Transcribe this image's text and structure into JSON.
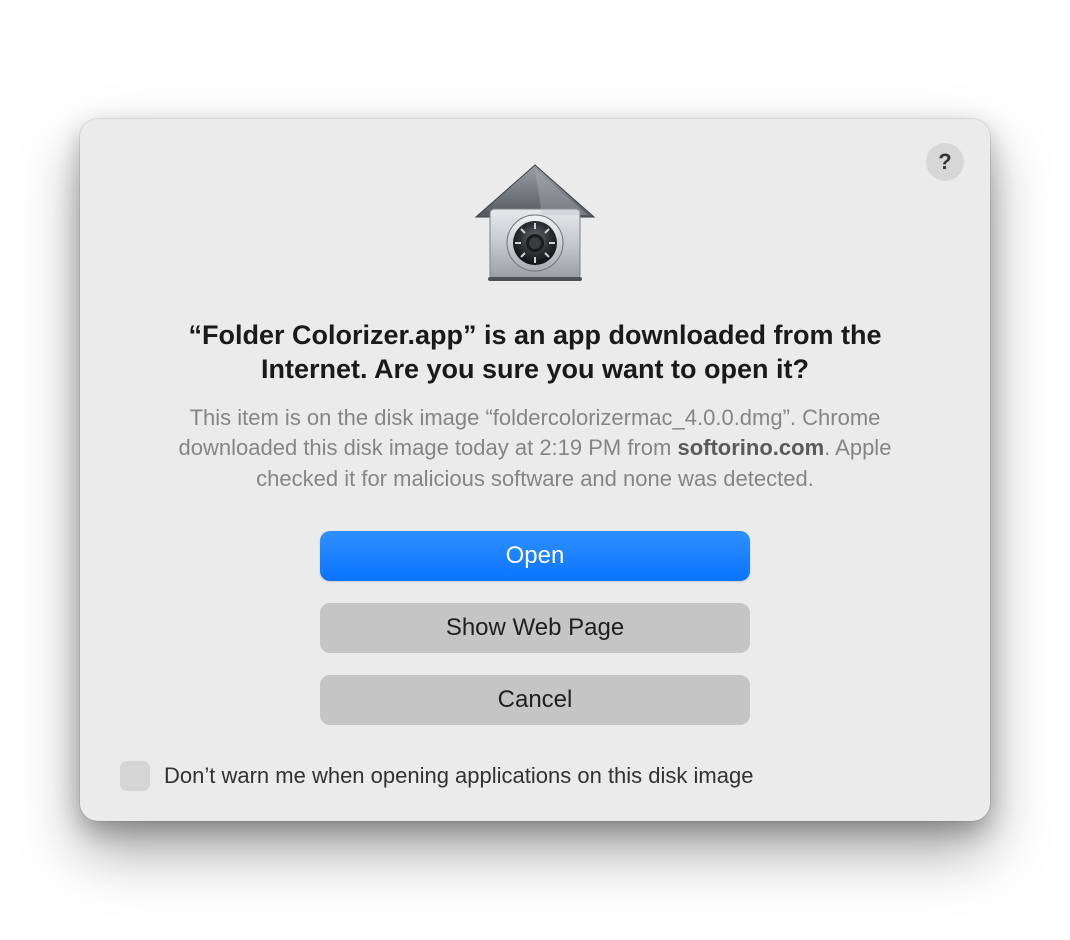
{
  "dialog": {
    "title": "“Folder Colorizer.app” is an app downloaded from the Internet. Are you sure you want to open it?",
    "subtitle_before": "This item is on the disk image “foldercolorizermac_4.0.0.dmg”. Chrome downloaded this disk image today at 2:19 PM from ",
    "subtitle_bold": "softorino.com",
    "subtitle_after": ". Apple checked it for malicious software and none was detected.",
    "buttons": {
      "open": "Open",
      "show_web_page": "Show Web Page",
      "cancel": "Cancel"
    },
    "checkbox_label": "Don’t warn me when opening applications on this disk image",
    "help_label": "?"
  }
}
